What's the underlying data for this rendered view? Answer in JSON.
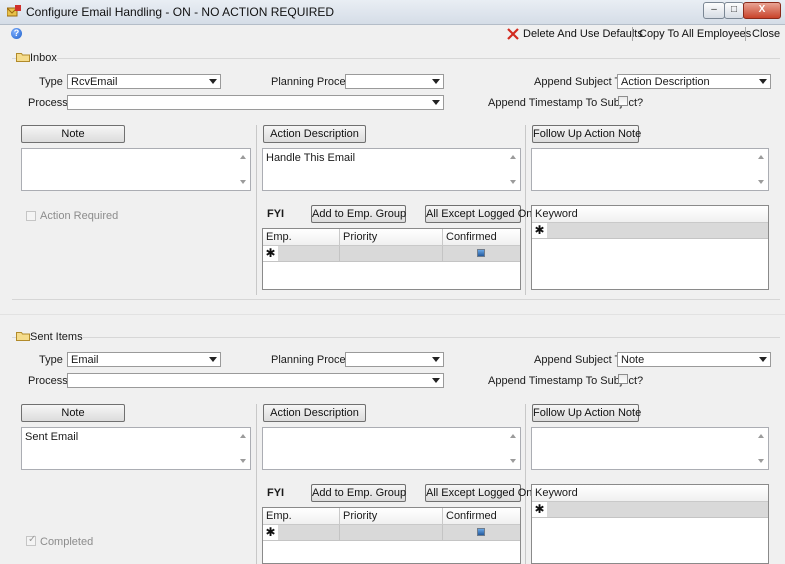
{
  "window": {
    "title": "Configure Email Handling - ON - NO ACTION REQUIRED"
  },
  "window_controls": {
    "minimize": "–",
    "maximize": "□",
    "close": "X"
  },
  "toolbar": {
    "help_glyph": "?",
    "delete_defaults": "Delete And Use Defaults",
    "copy_all": "Copy To All Employees",
    "close": "Close"
  },
  "labels": {
    "type": "Type",
    "process": "Process",
    "planning_process": "Planning Process",
    "append_subject_to": "Append Subject To",
    "append_timestamp": "Append Timestamp To Subject?",
    "note": "Note",
    "action_description": "Action Description",
    "follow_up_note": "Follow Up Action Note",
    "fyi": "FYI",
    "add_to_emp_group": "Add to Emp. Group",
    "all_except_logged_on": "All Except Logged On",
    "col_emp": "Emp.",
    "col_priority": "Priority",
    "col_confirmed": "Confirmed",
    "col_keyword": "Keyword",
    "new_row_glyph": "✱"
  },
  "inbox": {
    "group_label": "Inbox",
    "type_value": "RcvEmail",
    "planning_process_value": "",
    "process_value": "",
    "append_subject_value": "Action Description",
    "note_text": "",
    "action_description_text": "Handle This Email",
    "follow_up_text": "",
    "status_checkbox_label": "Action Required"
  },
  "sent": {
    "group_label": "Sent Items",
    "type_value": "Email",
    "planning_process_value": "",
    "process_value": "",
    "append_subject_value": "Note",
    "note_text": "Sent Email",
    "action_description_text": "",
    "follow_up_text": "",
    "status_checkbox_label": "Completed",
    "status_check_glyph": "✓"
  },
  "colors": {
    "close_icon": "#d22a1f",
    "titlebar": "#dfe5ec",
    "window_bg": "#f0f0f0"
  },
  "icons": {
    "app": "email-config-icon",
    "help": "help-icon",
    "delete": "x-icon",
    "group": "folder-icon"
  }
}
